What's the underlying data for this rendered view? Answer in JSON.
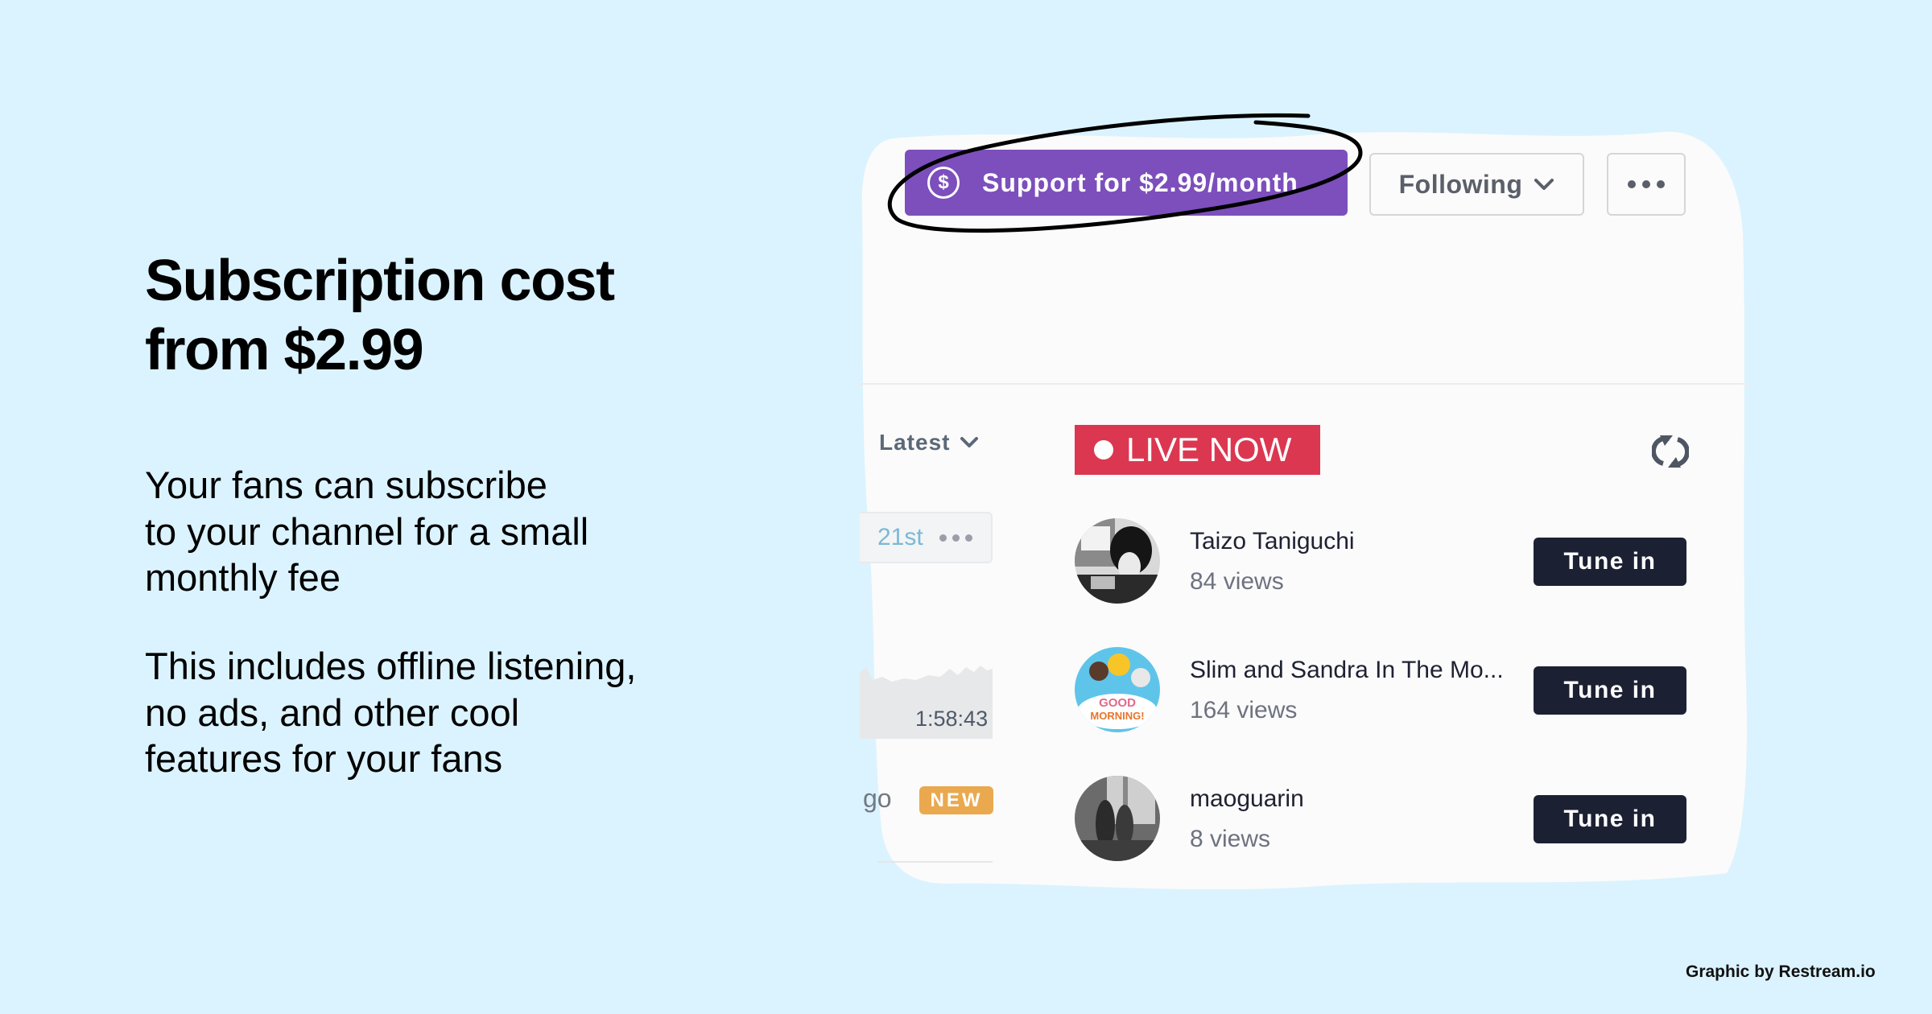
{
  "headline": {
    "line1": "Subscription cost",
    "line2": "from $2.99"
  },
  "paragraphs": [
    {
      "lines": [
        "Your fans can subscribe",
        "to your channel for a small",
        "monthly fee"
      ]
    },
    {
      "lines": [
        "This includes offline listening,",
        "no ads, and other cool",
        "features for your fans"
      ]
    }
  ],
  "credit": "Graphic by Restream.io",
  "profile_actions": {
    "support_label": "Support for $2.99/month",
    "support_icon": "dollar-circle-icon",
    "dollar_glyph": "$",
    "following_label": "Following",
    "following_icon": "chevron-down-icon",
    "more_icon": "more-horizontal-icon"
  },
  "feed": {
    "sort_label": "Latest",
    "live_label": "LIVE NOW",
    "refresh_icon": "refresh-icon",
    "left_card": {
      "date": "21st",
      "duration": "1:58:43",
      "ago_fragment": "go",
      "badge": "NEW"
    },
    "live_items": [
      {
        "name": "Taizo Taniguchi",
        "views": "84 views",
        "action": "Tune in"
      },
      {
        "name": "Slim and Sandra In The Mo...",
        "views": "164 views",
        "action": "Tune in"
      },
      {
        "name": "maoguarin",
        "views": "8 views",
        "action": "Tune in"
      }
    ]
  },
  "colors": {
    "background": "#dbf3fe",
    "support_purple": "#7c4fbc",
    "live_red": "#dc3750",
    "tune_in_navy": "#1c2033",
    "new_badge": "#eaa94e"
  }
}
